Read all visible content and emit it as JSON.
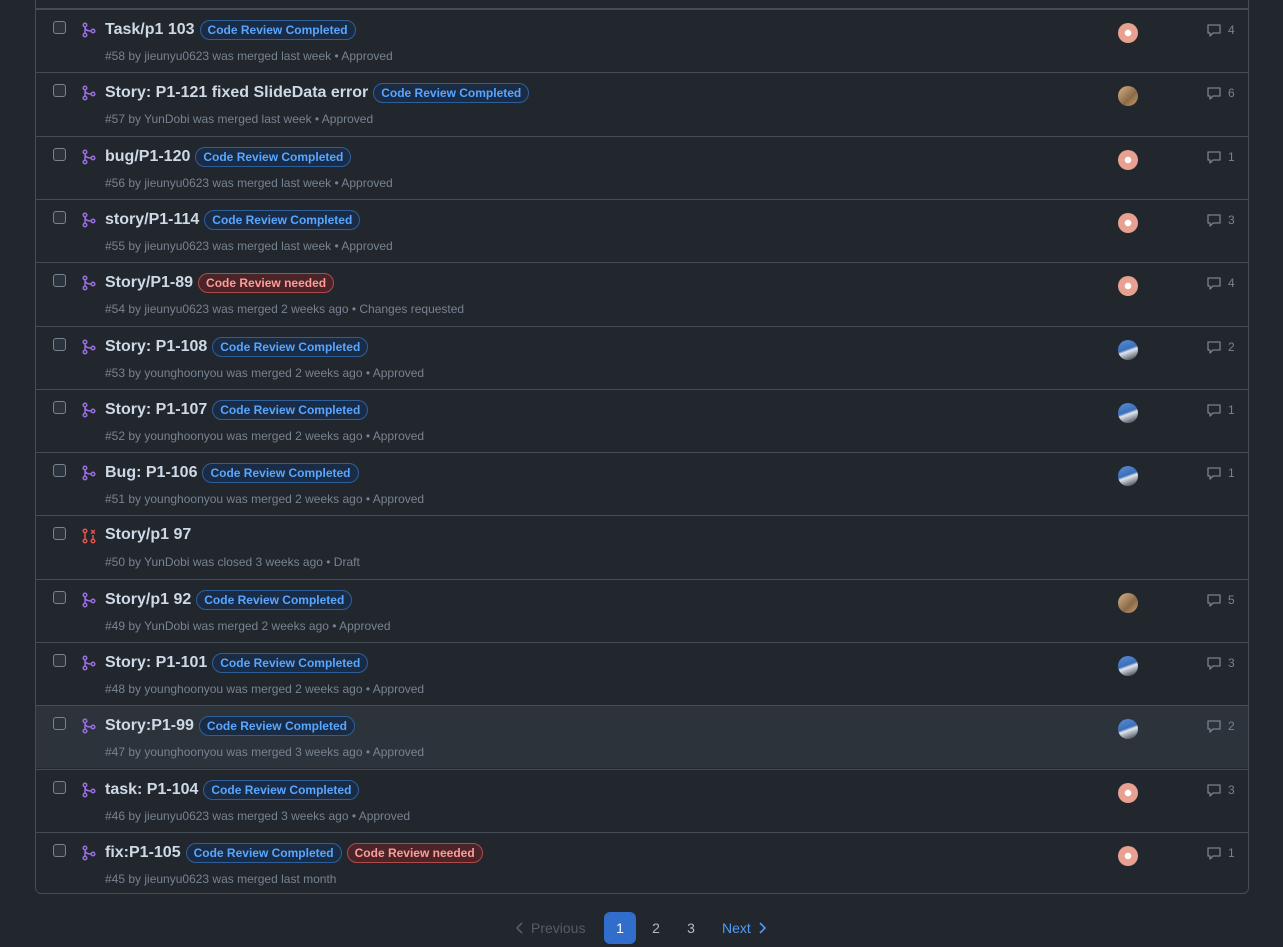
{
  "rows": [
    {
      "title": "Task/p1 103",
      "labels": [
        {
          "text": "Code Review Completed",
          "kind": "done"
        }
      ],
      "meta": "#58 by jieunyu0623 was merged last week • Approved",
      "state": "merged",
      "avatar": "pink",
      "comments": "4"
    },
    {
      "title": "Story: P1-121 fixed SlideData error",
      "labels": [
        {
          "text": "Code Review Completed",
          "kind": "done"
        }
      ],
      "meta": "#57 by YunDobi was merged last week • Approved",
      "state": "merged",
      "avatar": "tan",
      "comments": "6"
    },
    {
      "title": "bug/P1-120",
      "labels": [
        {
          "text": "Code Review Completed",
          "kind": "done"
        }
      ],
      "meta": "#56 by jieunyu0623 was merged last week • Approved",
      "state": "merged",
      "avatar": "pink",
      "comments": "1"
    },
    {
      "title": "story/P1-114",
      "labels": [
        {
          "text": "Code Review Completed",
          "kind": "done"
        }
      ],
      "meta": "#55 by jieunyu0623 was merged last week • Approved",
      "state": "merged",
      "avatar": "pink",
      "comments": "3"
    },
    {
      "title": "Story/P1-89",
      "labels": [
        {
          "text": "Code Review needed",
          "kind": "need"
        }
      ],
      "meta": "#54 by jieunyu0623 was merged 2 weeks ago • Changes requested",
      "state": "merged",
      "avatar": "pink",
      "comments": "4"
    },
    {
      "title": "Story: P1-108",
      "labels": [
        {
          "text": "Code Review Completed",
          "kind": "done"
        }
      ],
      "meta": "#53 by younghoonyou was merged 2 weeks ago • Approved",
      "state": "merged",
      "avatar": "blue",
      "comments": "2"
    },
    {
      "title": "Story: P1-107",
      "labels": [
        {
          "text": "Code Review Completed",
          "kind": "done"
        }
      ],
      "meta": "#52 by younghoonyou was merged 2 weeks ago • Approved",
      "state": "merged",
      "avatar": "blue",
      "comments": "1"
    },
    {
      "title": "Bug: P1-106",
      "labels": [
        {
          "text": "Code Review Completed",
          "kind": "done"
        }
      ],
      "meta": "#51 by younghoonyou was merged 2 weeks ago • Approved",
      "state": "merged",
      "avatar": "blue",
      "comments": "1"
    },
    {
      "title": "Story/p1 97",
      "labels": [],
      "meta": "#50 by YunDobi was closed 3 weeks ago • Draft",
      "state": "closed",
      "avatar": "",
      "comments": ""
    },
    {
      "title": "Story/p1 92",
      "labels": [
        {
          "text": "Code Review Completed",
          "kind": "done"
        }
      ],
      "meta": "#49 by YunDobi was merged 2 weeks ago • Approved",
      "state": "merged",
      "avatar": "tan",
      "comments": "5"
    },
    {
      "title": "Story: P1-101",
      "labels": [
        {
          "text": "Code Review Completed",
          "kind": "done"
        }
      ],
      "meta": "#48 by younghoonyou was merged 2 weeks ago • Approved",
      "state": "merged",
      "avatar": "blue",
      "comments": "3"
    },
    {
      "title": "Story:P1-99",
      "labels": [
        {
          "text": "Code Review Completed",
          "kind": "done"
        }
      ],
      "meta": "#47 by younghoonyou was merged 3 weeks ago • Approved",
      "state": "merged",
      "avatar": "blue",
      "comments": "2",
      "hover": true
    },
    {
      "title": "task: P1-104",
      "labels": [
        {
          "text": "Code Review Completed",
          "kind": "done"
        }
      ],
      "meta": "#46 by jieunyu0623 was merged 3 weeks ago • Approved",
      "state": "merged",
      "avatar": "pink",
      "comments": "3"
    },
    {
      "title": "fix:P1-105",
      "labels": [
        {
          "text": "Code Review Completed",
          "kind": "done"
        },
        {
          "text": "Code Review needed",
          "kind": "need"
        }
      ],
      "meta": "#45 by jieunyu0623 was merged last month",
      "state": "merged",
      "avatar": "pink",
      "comments": "1"
    }
  ],
  "pagination": {
    "previous": "Previous",
    "pages": [
      "1",
      "2",
      "3"
    ],
    "current": "1",
    "next": "Next"
  },
  "colors": {
    "merged": "#986ee2",
    "closed": "#e5534b",
    "background": "#22272e"
  }
}
